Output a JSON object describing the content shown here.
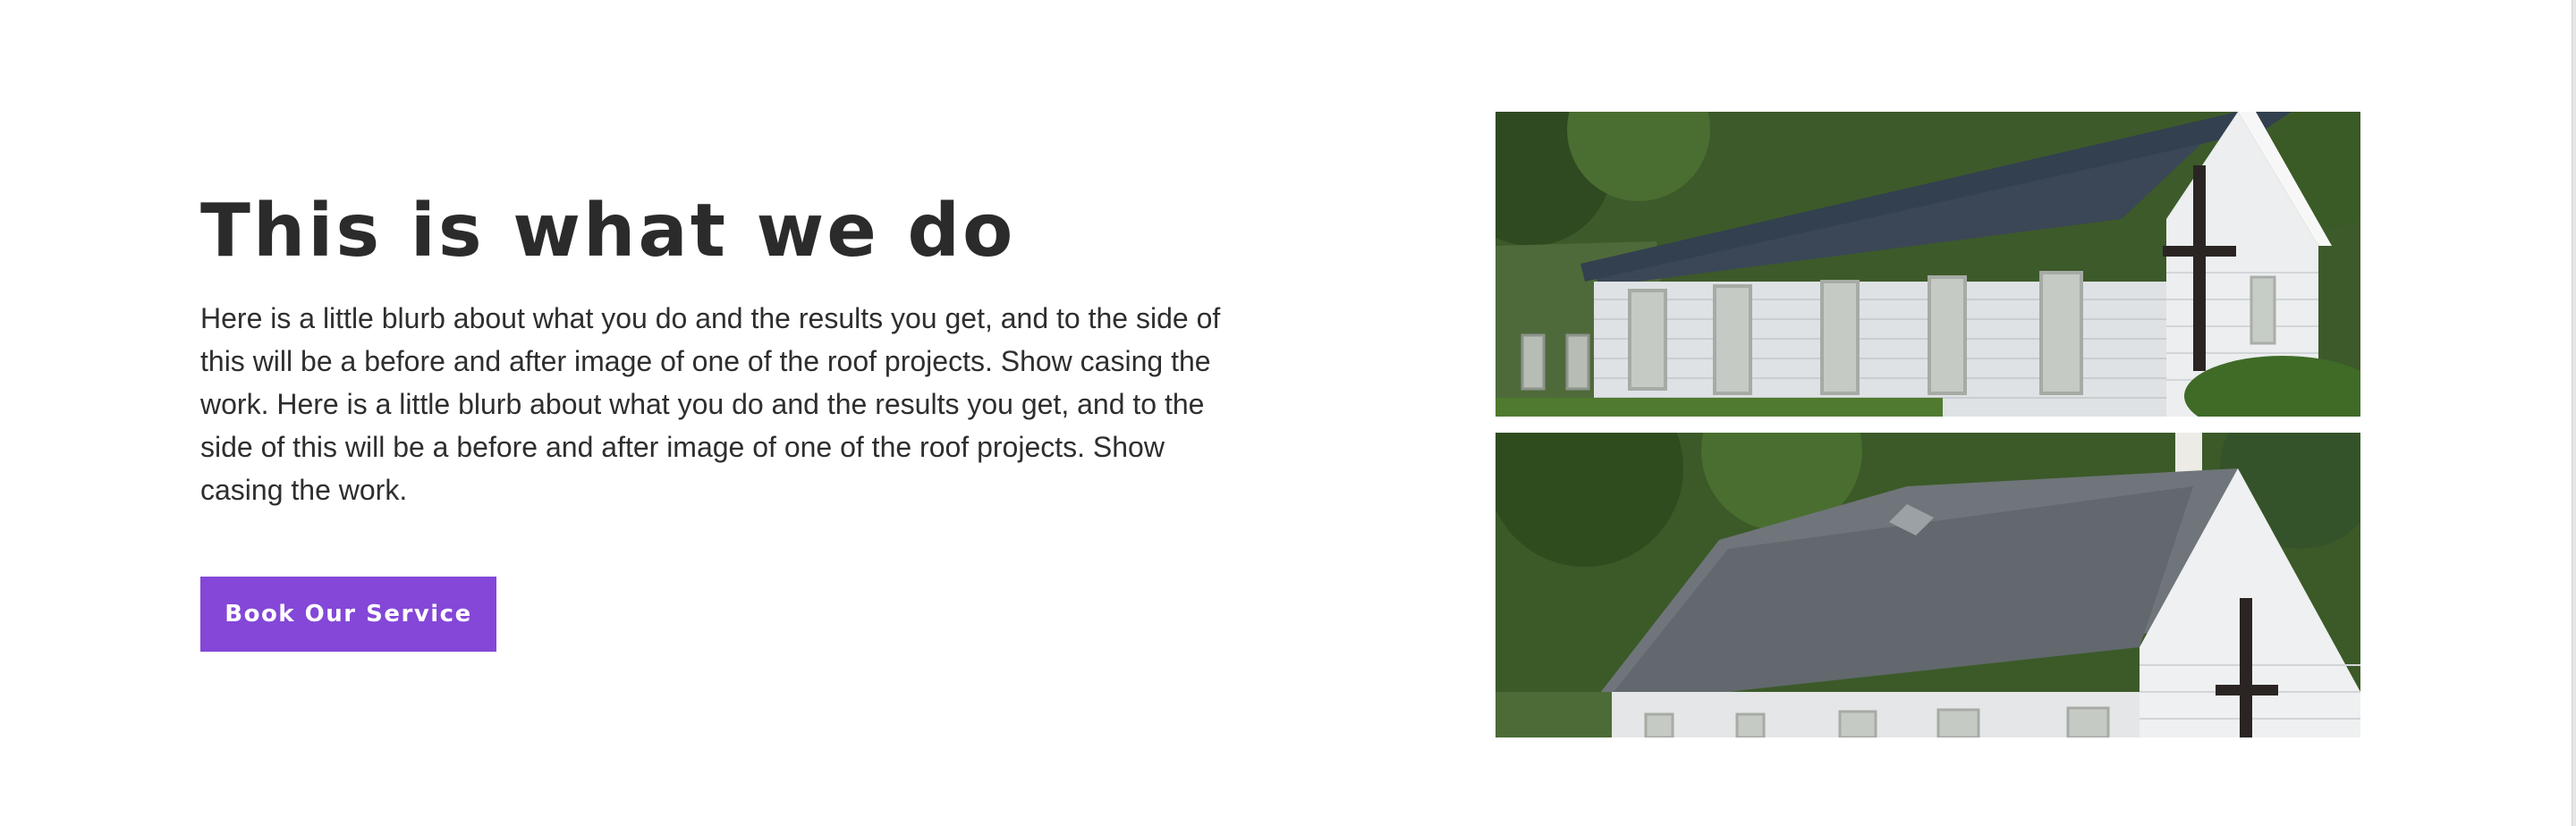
{
  "section": {
    "heading": "This is what we do",
    "blurb": "Here is a little blurb about what you do and the results you get, and to the side of this will be a before and after image of one of the roof projects. Show casing the work. Here is a little blurb about what you do and the results you get, and to the side of this will be a before and after image of one of the roof projects. Show casing the work.",
    "button_label": "Book Our Service"
  },
  "colors": {
    "accent": "#8447d8",
    "heading_text": "#2b2b2b",
    "body_text": "#2e2e2e",
    "background": "#ffffff"
  },
  "images": {
    "before": {
      "depicts": "white siding church with dark weathered shingle roof and cross"
    },
    "after": {
      "depicts": "white siding church with cleaned grey shingle roof and cross"
    }
  }
}
